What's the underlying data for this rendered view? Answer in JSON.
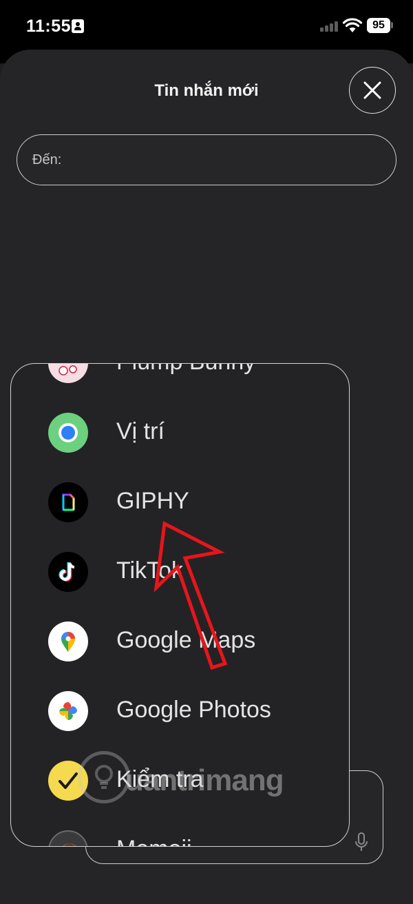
{
  "status_bar": {
    "time": "11:55",
    "battery": "95"
  },
  "header": {
    "title": "Tin nhắn mới",
    "close_icon": "close-icon"
  },
  "recipient": {
    "label": "Đến:"
  },
  "menu": {
    "items": [
      {
        "label": "Plump Bunny",
        "icon": "plump-bunny-sticker-icon"
      },
      {
        "label": "Vị trí",
        "icon": "location-icon"
      },
      {
        "label": "GIPHY",
        "icon": "giphy-icon"
      },
      {
        "label": "TikTok",
        "icon": "tiktok-icon"
      },
      {
        "label": "Google Maps",
        "icon": "google-maps-icon"
      },
      {
        "label": "Google Photos",
        "icon": "google-photos-icon"
      },
      {
        "label": "Kiểm tra",
        "icon": "checkmark-icon"
      },
      {
        "label": "Memoji",
        "icon": "memoji-icon"
      }
    ]
  },
  "watermark": {
    "text": "uantrimang"
  },
  "colors": {
    "sheet": "#252527",
    "annotation_arrow": "#e8151b"
  }
}
